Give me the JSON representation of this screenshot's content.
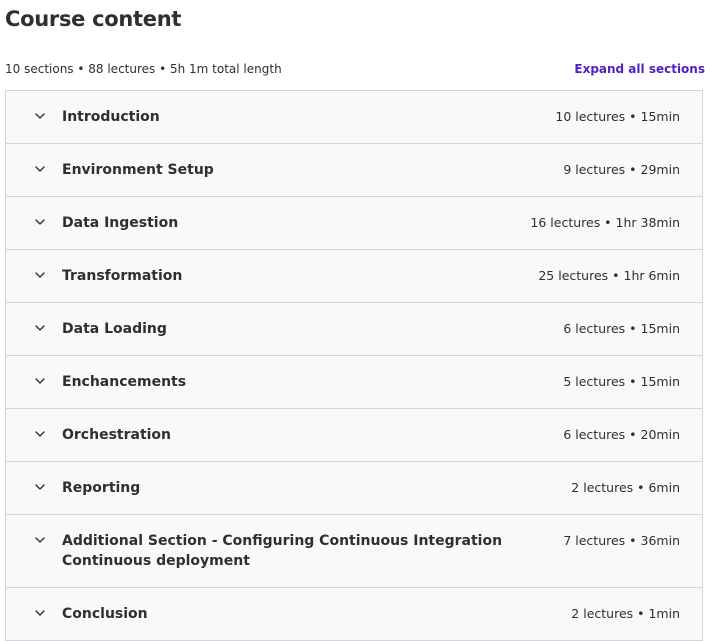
{
  "header": {
    "title": "Course content",
    "summary": "10 sections • 88 lectures • 5h 1m total length",
    "expand_all_label": "Expand all sections"
  },
  "colors": {
    "accent": "#5022c3",
    "section_bg": "#f7f9fa",
    "border": "#d1d7dc",
    "text": "#2d2f31"
  },
  "sections": [
    {
      "title": "Introduction",
      "meta": "10 lectures • 15min",
      "icon": "chevron-down-icon"
    },
    {
      "title": "Environment Setup",
      "meta": "9 lectures • 29min",
      "icon": "chevron-down-icon"
    },
    {
      "title": "Data Ingestion",
      "meta": "16 lectures • 1hr 38min",
      "icon": "chevron-down-icon"
    },
    {
      "title": "Transformation",
      "meta": "25 lectures • 1hr 6min",
      "icon": "chevron-down-icon"
    },
    {
      "title": "Data Loading",
      "meta": "6 lectures • 15min",
      "icon": "chevron-down-icon"
    },
    {
      "title": "Enchancements",
      "meta": "5 lectures • 15min",
      "icon": "chevron-down-icon"
    },
    {
      "title": "Orchestration",
      "meta": "6 lectures • 20min",
      "icon": "chevron-down-icon"
    },
    {
      "title": "Reporting",
      "meta": "2 lectures • 6min",
      "icon": "chevron-down-icon"
    },
    {
      "title": "Additional Section - Configuring Continuous Integration Continuous deployment",
      "meta": "7 lectures • 36min",
      "icon": "chevron-down-icon"
    },
    {
      "title": "Conclusion",
      "meta": "2 lectures • 1min",
      "icon": "chevron-down-icon"
    }
  ]
}
